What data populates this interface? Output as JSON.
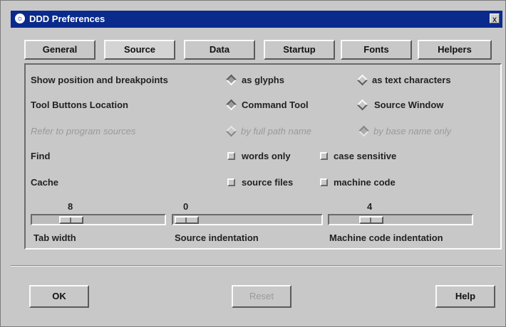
{
  "window": {
    "title": "DDD Preferences",
    "close_glyph": "x"
  },
  "tabs": [
    {
      "label": "General",
      "active": false
    },
    {
      "label": "Source",
      "active": true
    },
    {
      "label": "Data",
      "active": false
    },
    {
      "label": "Startup",
      "active": false
    },
    {
      "label": "Fonts",
      "active": false
    },
    {
      "label": "Helpers",
      "active": false
    }
  ],
  "rows": {
    "show_position": {
      "label": "Show position and breakpoints",
      "opt1": "as glyphs",
      "opt2": "as text characters",
      "selected": "opt1"
    },
    "tool_buttons": {
      "label": "Tool Buttons Location",
      "opt1": "Command Tool",
      "opt2": "Source Window",
      "selected": "opt1"
    },
    "refer_sources": {
      "label": "Refer to program sources",
      "opt1": "by full path name",
      "opt2": "by base name only",
      "selected": "opt2",
      "disabled": true
    },
    "find": {
      "label": "Find",
      "opt1": "words only",
      "opt2": "case sensitive",
      "opt1_checked": false,
      "opt2_checked": false
    },
    "cache": {
      "label": "Cache",
      "opt1": "source files",
      "opt2": "machine code",
      "opt1_checked": false,
      "opt2_checked": false
    }
  },
  "sliders": [
    {
      "value": "8",
      "label": "Tab width"
    },
    {
      "value": "0",
      "label": "Source indentation"
    },
    {
      "value": "4",
      "label": "Machine code indentation"
    }
  ],
  "buttons": {
    "ok": "OK",
    "reset": "Reset",
    "help": "Help"
  }
}
